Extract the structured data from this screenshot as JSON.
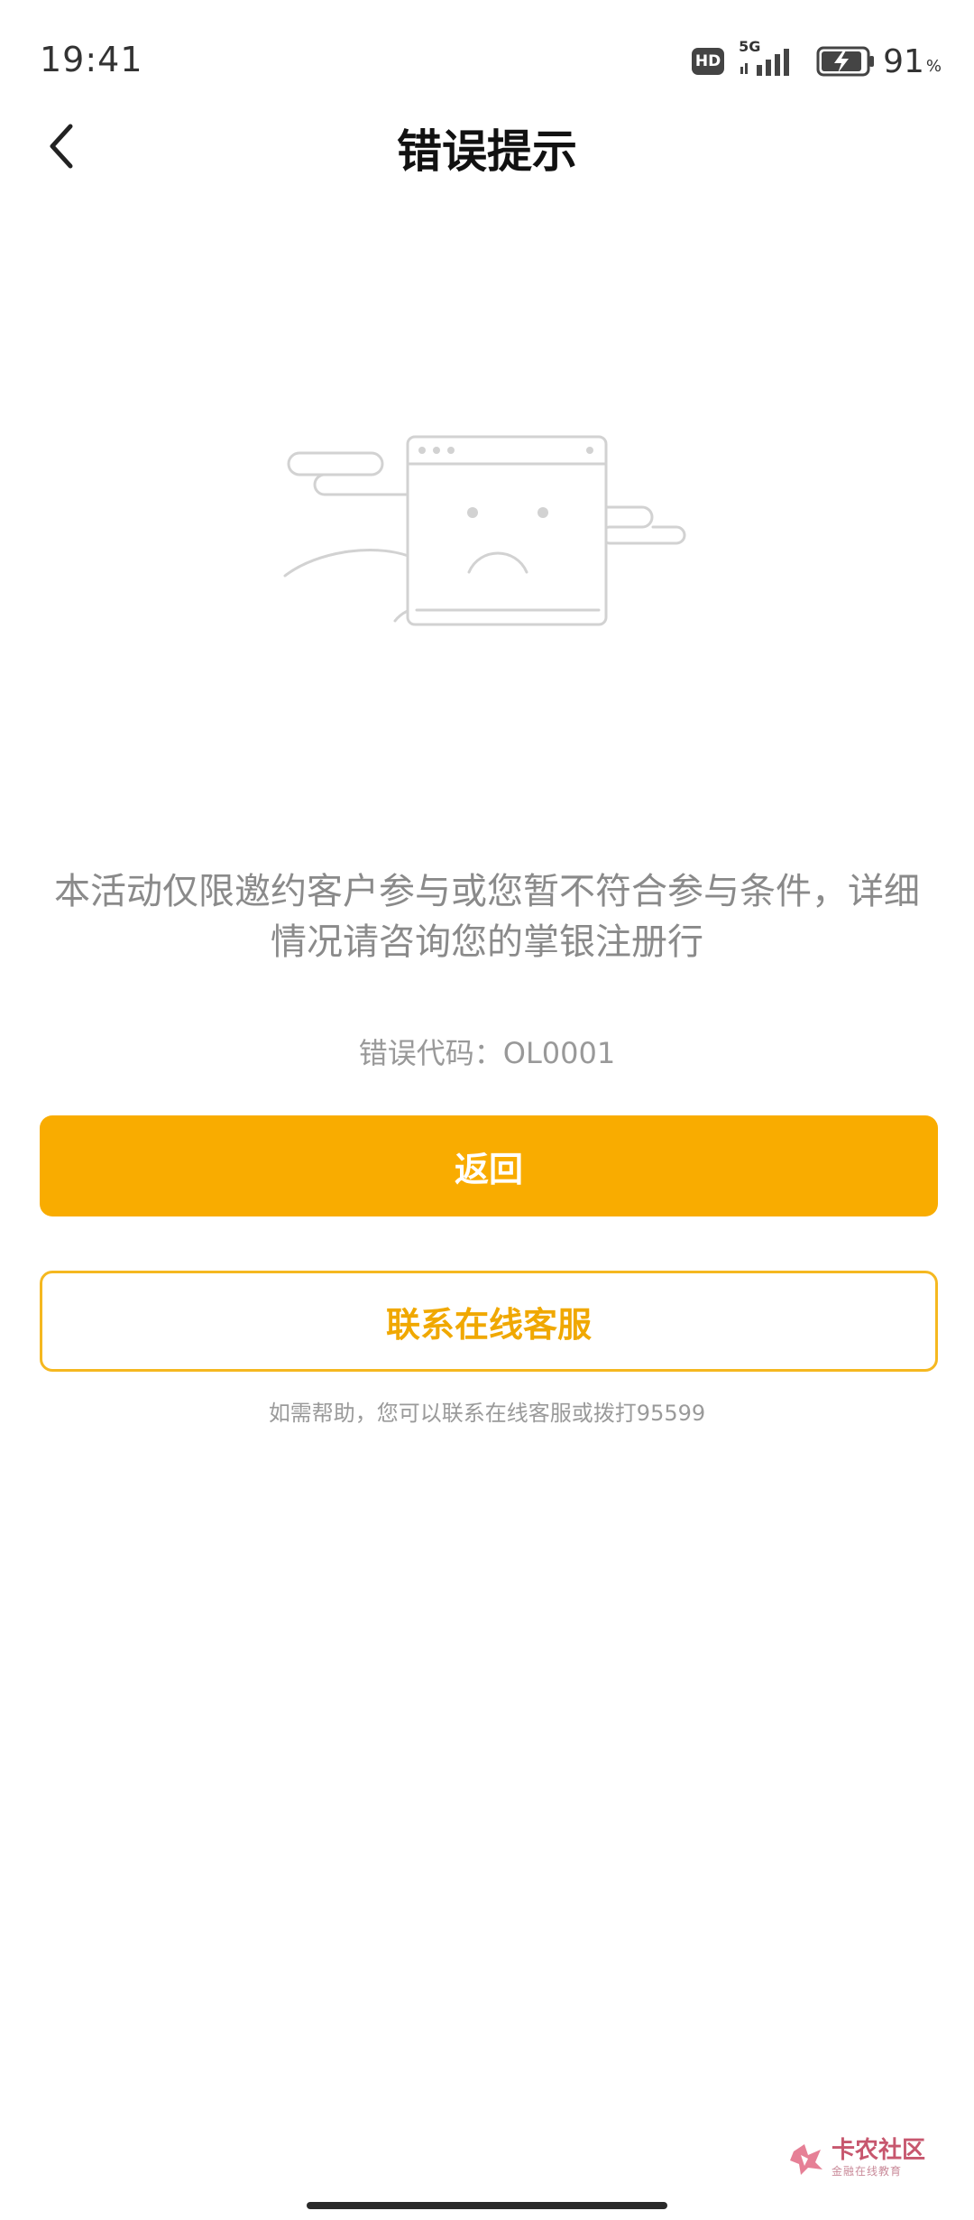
{
  "status_bar": {
    "time": "19:41",
    "hd": "HD",
    "network": "5G",
    "battery": "91",
    "battery_unit": "%"
  },
  "header": {
    "title": "错误提示",
    "back_icon": "chevron-left-icon"
  },
  "illustration": {
    "icon": "sad-browser-window-icon",
    "line_color": "#d2d2d2"
  },
  "message": {
    "text": "本活动仅限邀约客户参与或您暂不符合参与条件，详细情况请咨询您的掌银注册行",
    "error_code": "错误代码：OL0001"
  },
  "actions": {
    "back_label": "返回",
    "contact_label": "联系在线客服",
    "help_text": "如需帮助，您可以联系在线客服或拨打95599"
  },
  "watermark": {
    "title": "卡农社区",
    "subtitle": "金融在线教育"
  },
  "colors": {
    "accent": "#f9ac00",
    "outline": "#f5b820",
    "muted_text": "#8a8a8a"
  }
}
